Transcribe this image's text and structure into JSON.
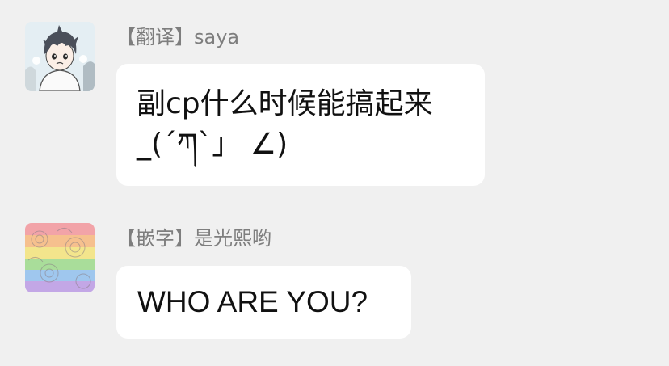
{
  "messages": [
    {
      "avatar_icon": "anime-boy-avatar-icon",
      "sender": "【翻译】saya",
      "lines": [
        "副cp什么时候能搞起来",
        "_(´ཀ`」 ∠)"
      ]
    },
    {
      "avatar_icon": "rainbow-floral-avatar-icon",
      "sender": "【嵌字】是光熙哟",
      "lines": [
        "WHO ARE YOU?"
      ]
    }
  ],
  "colors": {
    "background": "#f0f0f0",
    "bubble": "#ffffff",
    "sender_text": "#7e7e7e",
    "message_text": "#111111"
  }
}
